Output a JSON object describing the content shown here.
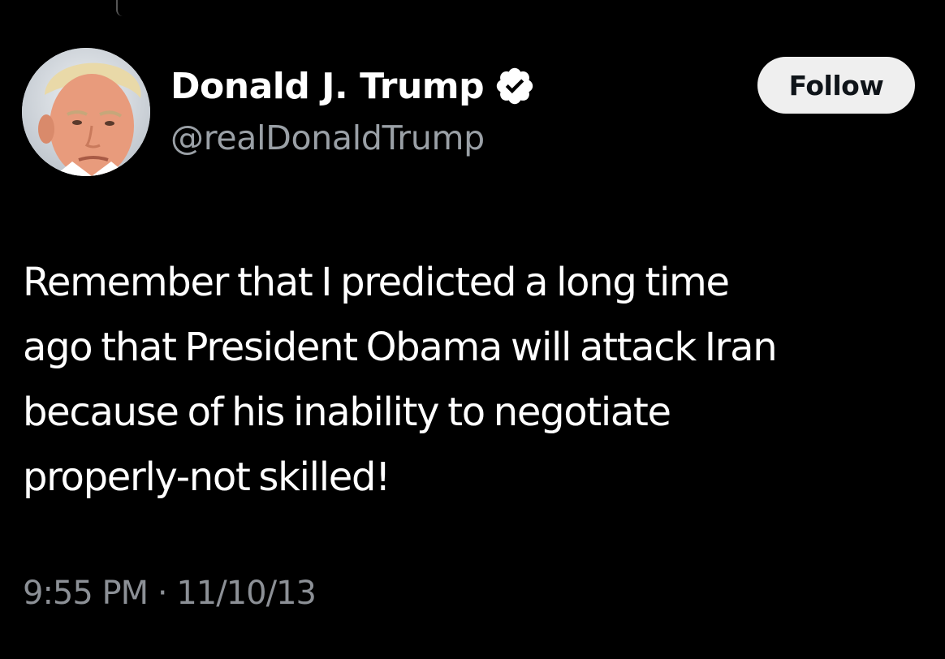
{
  "tweet": {
    "author": {
      "display_name": "Donald J. Trump",
      "handle": "@realDonaldTrump",
      "verified": true,
      "verified_icon": "verified-badge-icon",
      "avatar": "profile-photo"
    },
    "follow_label": "Follow",
    "text": "Remember that I predicted a long time\nago that President Obama will attack Iran\nbecause of his inability to negotiate\nproperly-not skilled!",
    "time": "9:55 PM",
    "separator": "·",
    "date": "11/10/13"
  },
  "colors": {
    "background": "#000000",
    "primary_text": "#ffffff",
    "secondary_text": "#9aa0a6",
    "follow_button_bg": "#efefef",
    "follow_button_text": "#0f1419"
  }
}
